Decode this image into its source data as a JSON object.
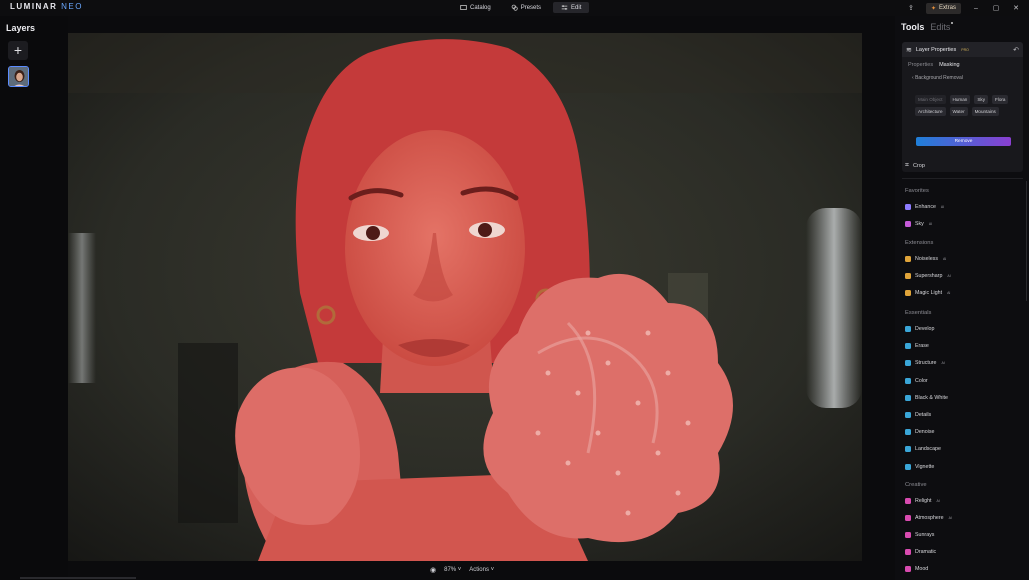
{
  "app": {
    "logo_main": "LUMINAR",
    "logo_accent": "NEO"
  },
  "nav": {
    "catalog": "Catalog",
    "presets": "Presets",
    "edit": "Edit"
  },
  "extras_label": "Extras",
  "layers": {
    "title": "Layers",
    "add_label": "+"
  },
  "canvas": {
    "zoom": "87%",
    "actions": "Actions"
  },
  "tools": {
    "title": "Tools",
    "edits": "Edits",
    "layer_properties": {
      "title": "Layer Properties",
      "badge": "PRO",
      "tabs": [
        "Properties",
        "Masking"
      ],
      "background_removal": "Background Removal",
      "chips": [
        "Main Object",
        "Human",
        "Sky",
        "Flora",
        "Architecture",
        "Water",
        "Mountains"
      ],
      "remove_label": "Remove"
    },
    "crop": "Crop",
    "sections": {
      "favorites": "Favorites",
      "extensions": "Extensions",
      "essentials": "Essentials",
      "creative": "Creative"
    },
    "favorites": [
      {
        "label": "Enhance",
        "ai": "AI",
        "color": "#8d7cff"
      },
      {
        "label": "Sky",
        "ai": "AI",
        "color": "#c55ad8"
      }
    ],
    "extensions": [
      {
        "label": "Noiseless",
        "ai": "AI",
        "color": "#e0a43a"
      },
      {
        "label": "Supersharp",
        "ai": "AI",
        "color": "#e0a43a"
      },
      {
        "label": "Magic Light",
        "ai": "AI",
        "color": "#e0a43a"
      }
    ],
    "essentials": [
      {
        "label": "Develop",
        "color": "#3aa6d8"
      },
      {
        "label": "Erase",
        "color": "#3aa6d8"
      },
      {
        "label": "Structure",
        "ai": "AI",
        "color": "#3aa6d8"
      },
      {
        "label": "Color",
        "color": "#3aa6d8"
      },
      {
        "label": "Black & White",
        "color": "#3aa6d8"
      },
      {
        "label": "Details",
        "color": "#3aa6d8"
      },
      {
        "label": "Denoise",
        "color": "#3aa6d8"
      },
      {
        "label": "Landscape",
        "color": "#3aa6d8"
      },
      {
        "label": "Vignette",
        "color": "#3aa6d8"
      }
    ],
    "creative": [
      {
        "label": "Relight",
        "ai": "AI",
        "color": "#d94bb0"
      },
      {
        "label": "Atmosphere",
        "ai": "AI",
        "color": "#d94bb0"
      },
      {
        "label": "Sunrays",
        "color": "#d94bb0"
      },
      {
        "label": "Dramatic",
        "color": "#d94bb0"
      },
      {
        "label": "Mood",
        "color": "#d94bb0"
      }
    ]
  }
}
